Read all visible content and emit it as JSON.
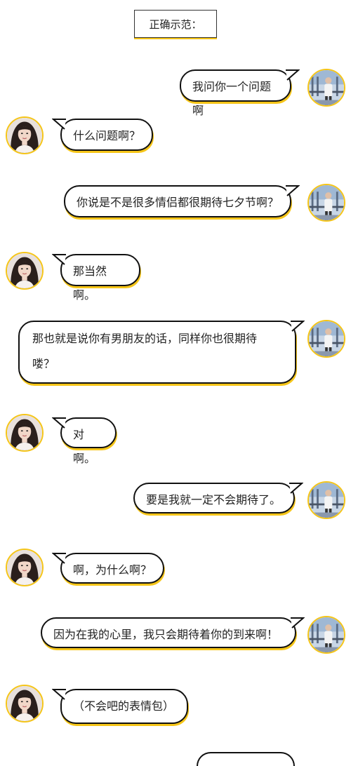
{
  "header": {
    "title": "正确示范："
  },
  "messages": [
    {
      "side": "right",
      "text": "我问你一个问题啊"
    },
    {
      "side": "left",
      "text": "什么问题啊？"
    },
    {
      "side": "right",
      "text": "你说是不是很多情侣都很期待七夕节啊？"
    },
    {
      "side": "left",
      "text": "那当然啊。"
    },
    {
      "side": "right",
      "line1": "那也就是说你有男朋友的话，同样你也很期待",
      "line2": "喽？"
    },
    {
      "side": "left",
      "text": "对啊。"
    },
    {
      "side": "right",
      "text": "要是我就一定不会期待了。"
    },
    {
      "side": "left",
      "text": "啊，为什么啊？"
    },
    {
      "side": "right",
      "text": "因为在我的心里，我只会期待着你的到来啊！"
    },
    {
      "side": "left",
      "text": "（不会吧的表情包）"
    }
  ],
  "colors": {
    "accent": "#f5c518",
    "border": "#111111"
  }
}
